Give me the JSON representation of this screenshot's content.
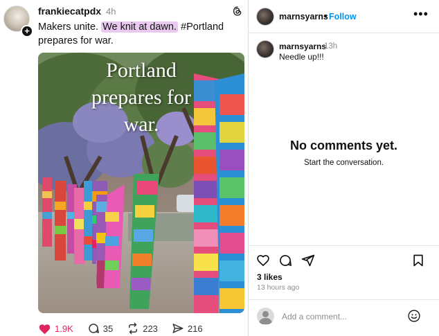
{
  "threads_post": {
    "username": "frankiecatpdx",
    "time": "4h",
    "text_before": "Makers unite. ",
    "text_highlight": "We knit at dawn.",
    "text_after": " #Portland prepares for war.",
    "photo_caption_lines": [
      "Portland",
      "prepares for",
      "war."
    ],
    "likes": "1.9K",
    "replies": "35",
    "reposts": "223",
    "shares": "216",
    "colors": {
      "like": "#e0245e",
      "highlight": "#e9c9ef"
    }
  },
  "instagram": {
    "header": {
      "username": "marnsyarns",
      "separator": "•",
      "follow_label": "Follow",
      "more_label": "•••"
    },
    "caption": {
      "username": "marnsyarns",
      "time": "13h",
      "text": "Needle up!!!"
    },
    "empty_state": {
      "title": "No comments yet.",
      "subtitle": "Start the conversation."
    },
    "likes": "3 likes",
    "time_ago": "13 hours ago",
    "comment_placeholder": "Add a comment...",
    "colors": {
      "follow": "#0095f6"
    },
    "icons": [
      "heart-icon",
      "comment-icon",
      "share-icon",
      "bookmark-icon",
      "emoji-icon"
    ]
  }
}
